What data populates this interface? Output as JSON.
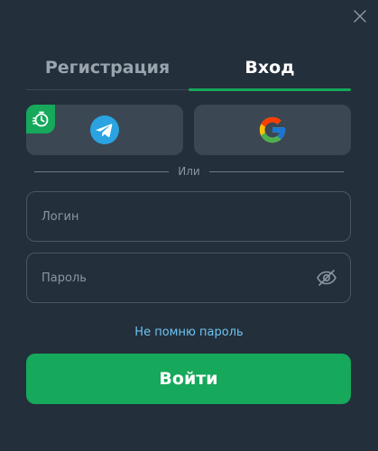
{
  "tabs": {
    "register": "Регистрация",
    "login": "Вход"
  },
  "social": {
    "telegram_icon": "telegram-icon",
    "google_icon": "google-icon",
    "badge_icon": "stopwatch-icon"
  },
  "divider": {
    "text": "Или"
  },
  "fields": {
    "login_placeholder": "Логин",
    "password_placeholder": "Пароль"
  },
  "forgot_password": "Не помню пароль",
  "submit_label": "Войти",
  "colors": {
    "background": "#232f3b",
    "accent": "#16a85b",
    "link": "#6fc3f0",
    "button_secondary": "#3b4753"
  }
}
